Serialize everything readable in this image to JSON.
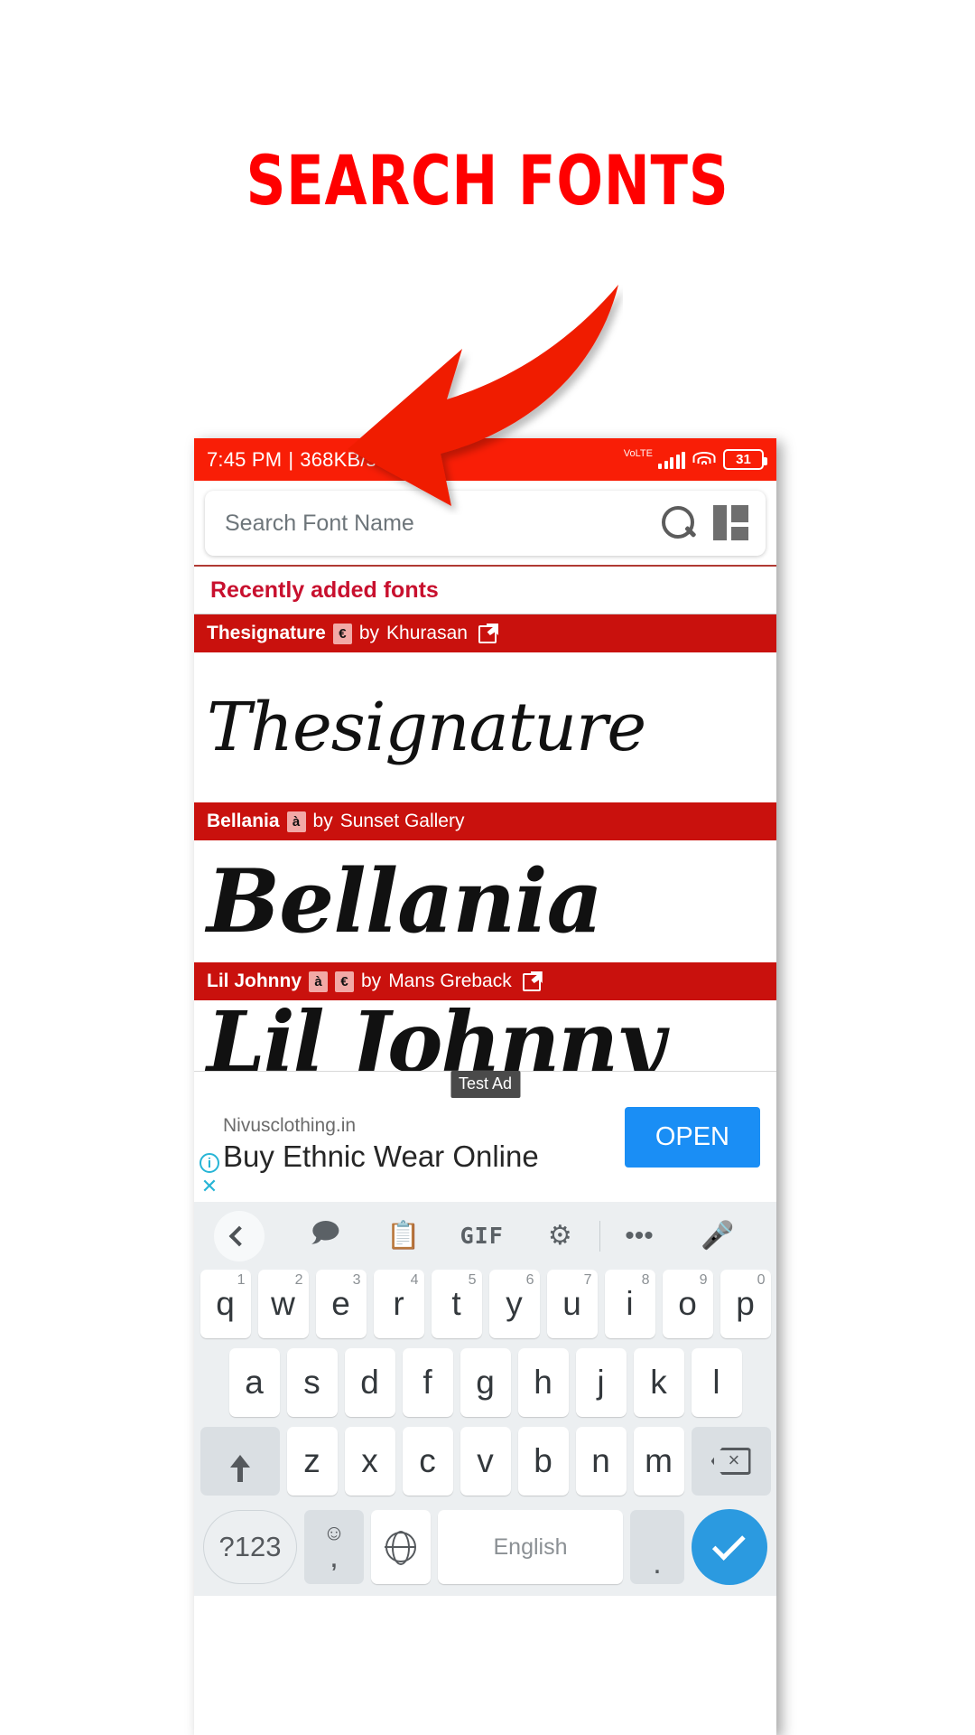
{
  "promo": {
    "title": "SEARCH FONTS",
    "accent_color": "#FF0000"
  },
  "status_bar": {
    "time": "7:45 PM",
    "separator": "|",
    "network_speed": "368KB/s",
    "alarm_icon": "alarm-icon",
    "whatsapp_icon": "whatsapp-icon",
    "network_label": "VoLTE",
    "battery_percent": "31",
    "background_color": "#F91E06"
  },
  "search": {
    "placeholder": "Search Font Name",
    "value": "",
    "search_icon": "search-icon",
    "grid_icon": "grid-view-icon"
  },
  "section": {
    "title": "Recently added fonts",
    "title_color": "#C8102E"
  },
  "fonts": [
    {
      "name": "Thesignature",
      "badges": [
        "€"
      ],
      "by_label": "by",
      "author": "Khurasan",
      "has_external_link": true,
      "preview_text": "Thesignature"
    },
    {
      "name": "Bellania",
      "badges": [
        "à"
      ],
      "by_label": "by",
      "author": "Sunset Gallery",
      "has_external_link": false,
      "preview_text": "Bellania"
    },
    {
      "name": "Lil Johnny",
      "badges": [
        "à",
        "€"
      ],
      "by_label": "by",
      "author": "Mans Greback",
      "has_external_link": true,
      "preview_text": "Lil Johnny"
    }
  ],
  "ad": {
    "test_label": "Test Ad",
    "site": "Nivusclothing.in",
    "headline": "Buy Ethnic Wear Online",
    "cta": "OPEN",
    "cta_color": "#1A8EF5",
    "info_icon": "info-icon",
    "close_icon": "close-icon"
  },
  "keyboard": {
    "toolbar": {
      "back_icon": "chevron-left-icon",
      "sticker_icon": "sticker-icon",
      "clipboard_icon": "clipboard-icon",
      "gif_label": "GIF",
      "settings_icon": "gear-icon",
      "more_icon": "more-horizontal-icon",
      "mic_icon": "microphone-icon"
    },
    "row1": [
      {
        "key": "q",
        "num": "1"
      },
      {
        "key": "w",
        "num": "2"
      },
      {
        "key": "e",
        "num": "3"
      },
      {
        "key": "r",
        "num": "4"
      },
      {
        "key": "t",
        "num": "5"
      },
      {
        "key": "y",
        "num": "6"
      },
      {
        "key": "u",
        "num": "7"
      },
      {
        "key": "i",
        "num": "8"
      },
      {
        "key": "o",
        "num": "9"
      },
      {
        "key": "p",
        "num": "0"
      }
    ],
    "row2": [
      "a",
      "s",
      "d",
      "f",
      "g",
      "h",
      "j",
      "k",
      "l"
    ],
    "row3": [
      "z",
      "x",
      "c",
      "v",
      "b",
      "n",
      "m"
    ],
    "shift_icon": "shift-arrow-icon",
    "backspace_icon": "backspace-icon",
    "symbols_label": "?123",
    "emoji_icon": "emoji-icon",
    "comma_label": ",",
    "globe_icon": "globe-icon",
    "space_label": "English",
    "period_label": ".",
    "enter_icon": "checkmark-icon",
    "enter_color": "#2B9AE0"
  }
}
